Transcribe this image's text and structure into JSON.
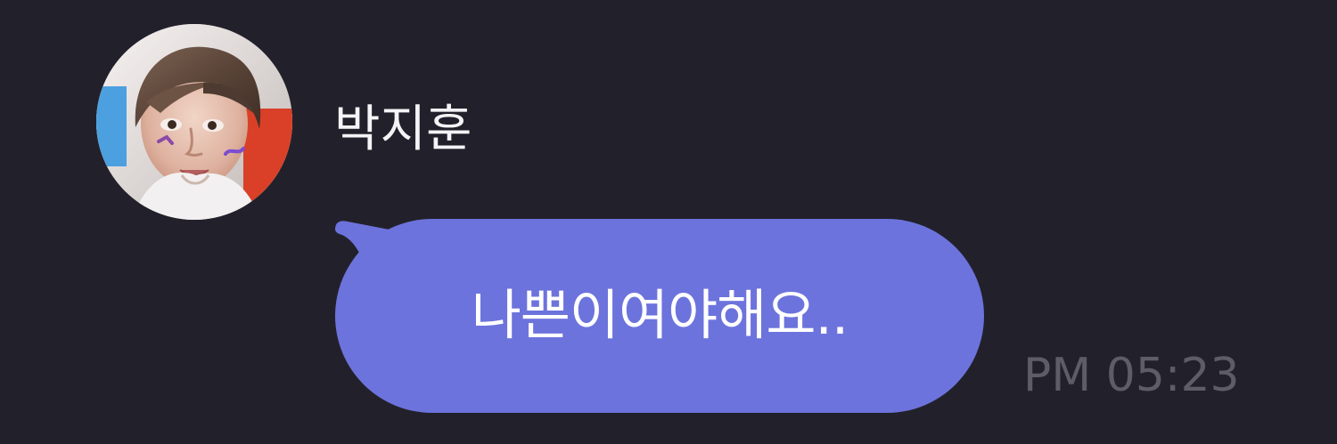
{
  "message": {
    "sender_name": "박지훈",
    "text": "나쁜이여야해요..",
    "timestamp": "PM 05:23",
    "avatar": "profile-photo"
  },
  "colors": {
    "background": "#22212b",
    "bubble": "#6d73dc",
    "name_text": "#f4f4f6",
    "message_text": "#ffffff",
    "timestamp_text": "#5e5d66"
  }
}
